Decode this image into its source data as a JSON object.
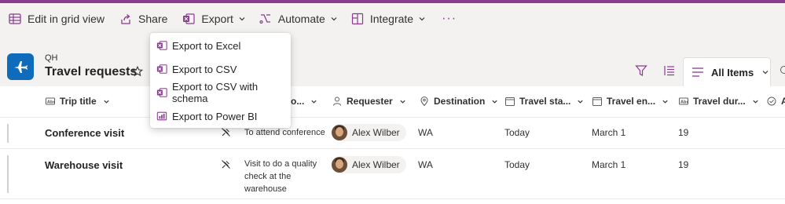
{
  "colors": {
    "accent": "#8a3b8f",
    "brand": "#0f6cbd"
  },
  "commandbar": {
    "edit_grid": "Edit in grid view",
    "share": "Share",
    "export": "Export",
    "automate": "Automate",
    "integrate": "Integrate",
    "more": "···"
  },
  "export_menu": {
    "items": [
      "Export to Excel",
      "Export to CSV",
      "Export to CSV with schema",
      "Export to Power BI"
    ]
  },
  "site": {
    "abbrev": "QH",
    "list_title": "Travel requests"
  },
  "view": {
    "name": "All Items"
  },
  "columns": {
    "trip_title": "Trip title",
    "purpose_partial": "o...",
    "requester": "Requester",
    "destination": "Destination",
    "travel_start": "Travel sta...",
    "travel_end": "Travel en...",
    "travel_duration": "Travel dur...",
    "approval_partial": "A"
  },
  "rows": [
    {
      "title": "Conference visit",
      "purpose": "To attend conference",
      "requester": "Alex Wilber",
      "destination": "WA",
      "start": "Today",
      "end": "March 1",
      "duration": "19"
    },
    {
      "title": "Warehouse visit",
      "purpose": "Visit to do a quality check at the warehouse",
      "requester": "Alex Wilber",
      "destination": "WA",
      "start": "Today",
      "end": "March 1",
      "duration": "19"
    }
  ]
}
